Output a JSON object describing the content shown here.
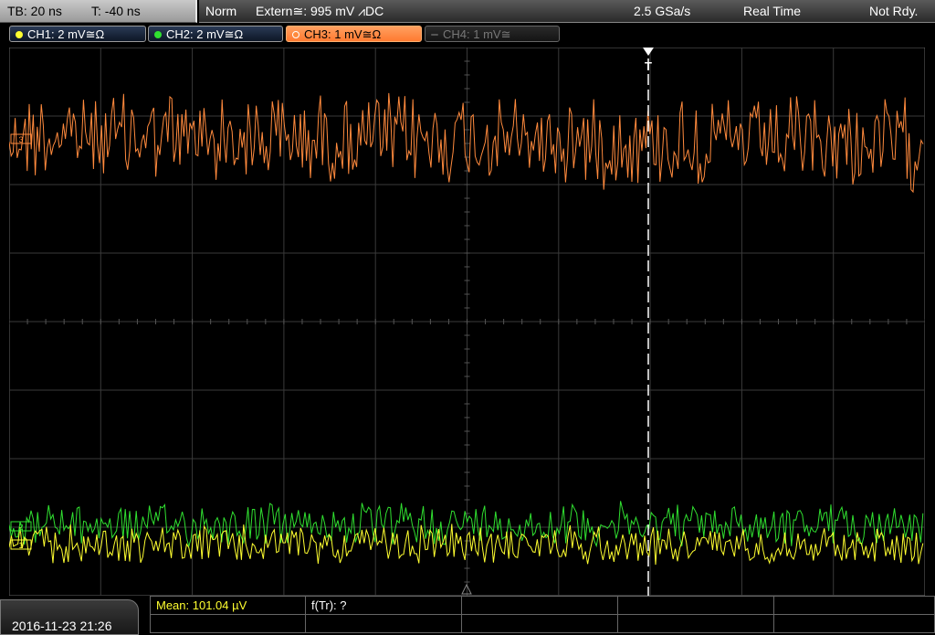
{
  "timebase": {
    "tb": "TB: 20 ns",
    "t": "T: -40 ns"
  },
  "status": {
    "mode": "Norm",
    "trigger": "Extern≅: 995 mV ⩘DC",
    "sample_rate": "2.5 GSa/s",
    "acquisition": "Real Time",
    "state": "Not Rdy."
  },
  "channels": [
    {
      "label": "CH1: 2 mV≅Ω",
      "color": "#ffff30",
      "active": false,
      "enabled": true
    },
    {
      "label": "CH2: 2 mV≅Ω",
      "color": "#30e030",
      "active": false,
      "enabled": true
    },
    {
      "label": "CH3: 1 mV≅Ω",
      "color": "#ff8a3d",
      "active": true,
      "enabled": true
    },
    {
      "label": "CH4: 1 mV≅",
      "color": "#777777",
      "active": false,
      "enabled": false
    }
  ],
  "trigger_marker": "T",
  "markers": {
    "ch1": "1",
    "ch2": "2",
    "ch3": "3"
  },
  "measurements": {
    "mean": "Mean: 101.04 µV",
    "ftr": "f(Tr): ?"
  },
  "datetime": "2016-11-23 21:26",
  "colors": {
    "grid": "#3a3a3a",
    "ch1": "#ffff30",
    "ch2": "#30e030",
    "ch3": "#ff8a3d",
    "trigger": "#ffffff"
  }
}
